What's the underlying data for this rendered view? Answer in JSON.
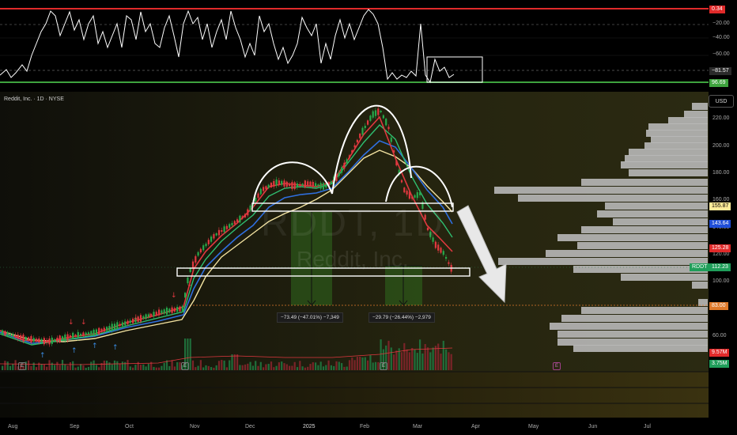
{
  "chart": {
    "symbol_watermark": "RDDT, 1D",
    "name_watermark": "Reddit, Inc.",
    "title": "Reddit, Inc. · 1D · NYSE",
    "currency": "USD"
  },
  "indicator_pane": {
    "ticks": [
      "−20.00",
      "−40.00",
      "−60.00"
    ],
    "tags": [
      {
        "text": "0.34",
        "color": "#e02a2a"
      },
      {
        "text": "−81.57",
        "color": "#2a2a2a"
      },
      {
        "text": "96.69",
        "color": "#3ea33e"
      }
    ]
  },
  "price_axis": {
    "ticks": [
      "220.00",
      "200.00",
      "180.00",
      "160.00",
      "140.00",
      "120.00",
      "100.00",
      "80.00",
      "60.00"
    ],
    "tags": [
      {
        "text": "155.87",
        "color": "#ffec99",
        "text_color": "#000"
      },
      {
        "text": "143.64",
        "color": "#1f4ed8",
        "text_color": "#fff"
      },
      {
        "text": "125.28",
        "color": "#e02a2a",
        "text_color": "#fff"
      },
      {
        "text": "RDDT",
        "color": "#1f9e5a",
        "text_color": "#fff"
      },
      {
        "text": "112.23",
        "color": "#1f9e5a",
        "text_color": "#fff"
      },
      {
        "text": "83.00",
        "color": "#e07a2a",
        "text_color": "#fff"
      },
      {
        "text": "9.57M",
        "color": "#e02a2a",
        "text_color": "#fff"
      },
      {
        "text": "3.75M",
        "color": "#1f9e5a",
        "text_color": "#fff"
      }
    ]
  },
  "measures": [
    {
      "text": "−73.49 (−47.01%) −7,349"
    },
    {
      "text": "−29.79 (−26.44%) −2,979"
    }
  ],
  "time_axis": {
    "months": [
      "Aug",
      "Sep",
      "Oct",
      "Nov",
      "Dec",
      "2025",
      "Feb",
      "Mar",
      "Apr",
      "May",
      "Jun",
      "Jul"
    ]
  },
  "markers": {
    "earnings": [
      "E",
      "E",
      "E",
      "E"
    ]
  },
  "colors": {
    "up": "#27a84a",
    "down": "#e0383f",
    "ma_fast": "#e0383f",
    "ma_mid": "#2fbf71",
    "ma_slow": "#2f6fe0",
    "ma_long": "#f2e2a0",
    "neckline": "#ffffff",
    "projection": "#ffffff"
  }
}
